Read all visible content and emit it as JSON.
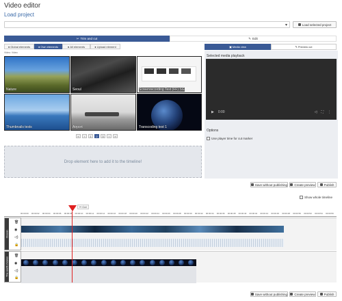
{
  "page_title": "Video editor",
  "load_project_link": "Load project",
  "load_button": "Load selected project",
  "main_tabs": [
    "Trim and cut",
    "Edit"
  ],
  "source_tabs": [
    "Global elements",
    "Own elements",
    "All elements",
    "Upload element"
  ],
  "filter_label": "Video: Video",
  "thumbnails": [
    {
      "caption": "Nature"
    },
    {
      "caption": "Seoul"
    },
    {
      "caption": "Screenrecording Test (FF) SG"
    },
    {
      "caption": "Thumbnails tests"
    },
    {
      "caption": "Airport"
    },
    {
      "caption": "Transcoding test 1"
    }
  ],
  "pagination": [
    "«",
    "‹",
    "1",
    "2",
    "3",
    "›",
    "»"
  ],
  "pagination_active": "2",
  "dropzone_text": "Drop element here to add it to the timeline!",
  "right_tabs": [
    "Media view",
    "Preview cut"
  ],
  "selected_media_label": "Selected media playback",
  "video_time": "0:00",
  "options_label": "Options",
  "use_player_time_label": "Use player time for cut marker",
  "actions": {
    "save_without_publishing": "Save without publishing",
    "create_preview": "Create preview",
    "publish": "Publish"
  },
  "show_whole_timeline": "Show whole timeline",
  "cut_label": "Cut",
  "timeline_ticks": [
    "00:00:00",
    "00:00:02",
    "00:00:04",
    "00:00:06",
    "00:00:08",
    "00:00:10",
    "00:00:12",
    "00:00:14",
    "00:00:16",
    "00:00:18",
    "00:00:20",
    "00:00:22",
    "00:00:24",
    "00:00:26",
    "00:00:28",
    "00:00:30",
    "00:00:32",
    "00:00:34",
    "00:00:36",
    "00:00:38",
    "00:00:40",
    "00:00:42",
    "00:00:44",
    "00:00:46",
    "00:00:48",
    "00:00:50",
    "00:00:52",
    "00:00:54",
    "00:00:56"
  ],
  "tracks": [
    {
      "name": "Ocean"
    },
    {
      "name": "The earth moves"
    }
  ],
  "colors": {
    "primary": "#3a5a96",
    "playhead": "#e02020",
    "lane_bg": "#f3f3f3"
  }
}
